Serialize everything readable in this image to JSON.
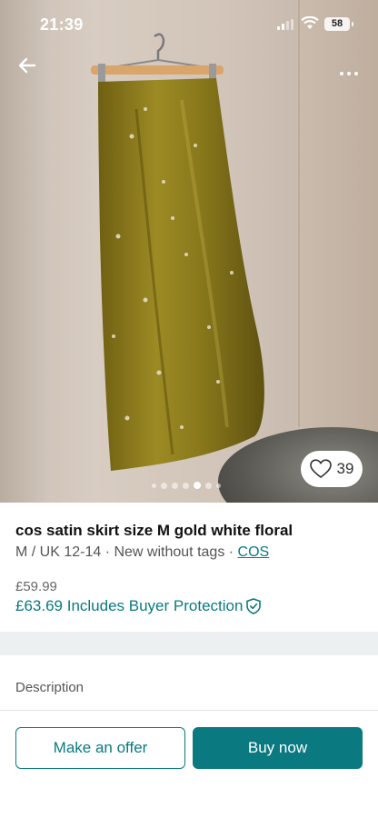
{
  "status_bar": {
    "time": "21:39",
    "battery": "58"
  },
  "listing": {
    "title": "cos satin skirt size M gold white floral",
    "size_condition": "M / UK 12-14 · New without tags · ",
    "brand": "COS",
    "price": "£59.99",
    "total_price": "£63.69 Includes Buyer Protection",
    "favourites": "39"
  },
  "carousel": {
    "count": 7,
    "active_index": 4
  },
  "description_label": "Description",
  "actions": {
    "offer_label": "Make an offer",
    "buy_label": "Buy now"
  },
  "colors": {
    "accent": "#0a7a80",
    "skirt": "#8a7a1e"
  },
  "icons": [
    "back-arrow-icon",
    "more-icon",
    "heart-icon",
    "shield-check-icon",
    "signal-icon",
    "wifi-icon",
    "battery-icon"
  ]
}
